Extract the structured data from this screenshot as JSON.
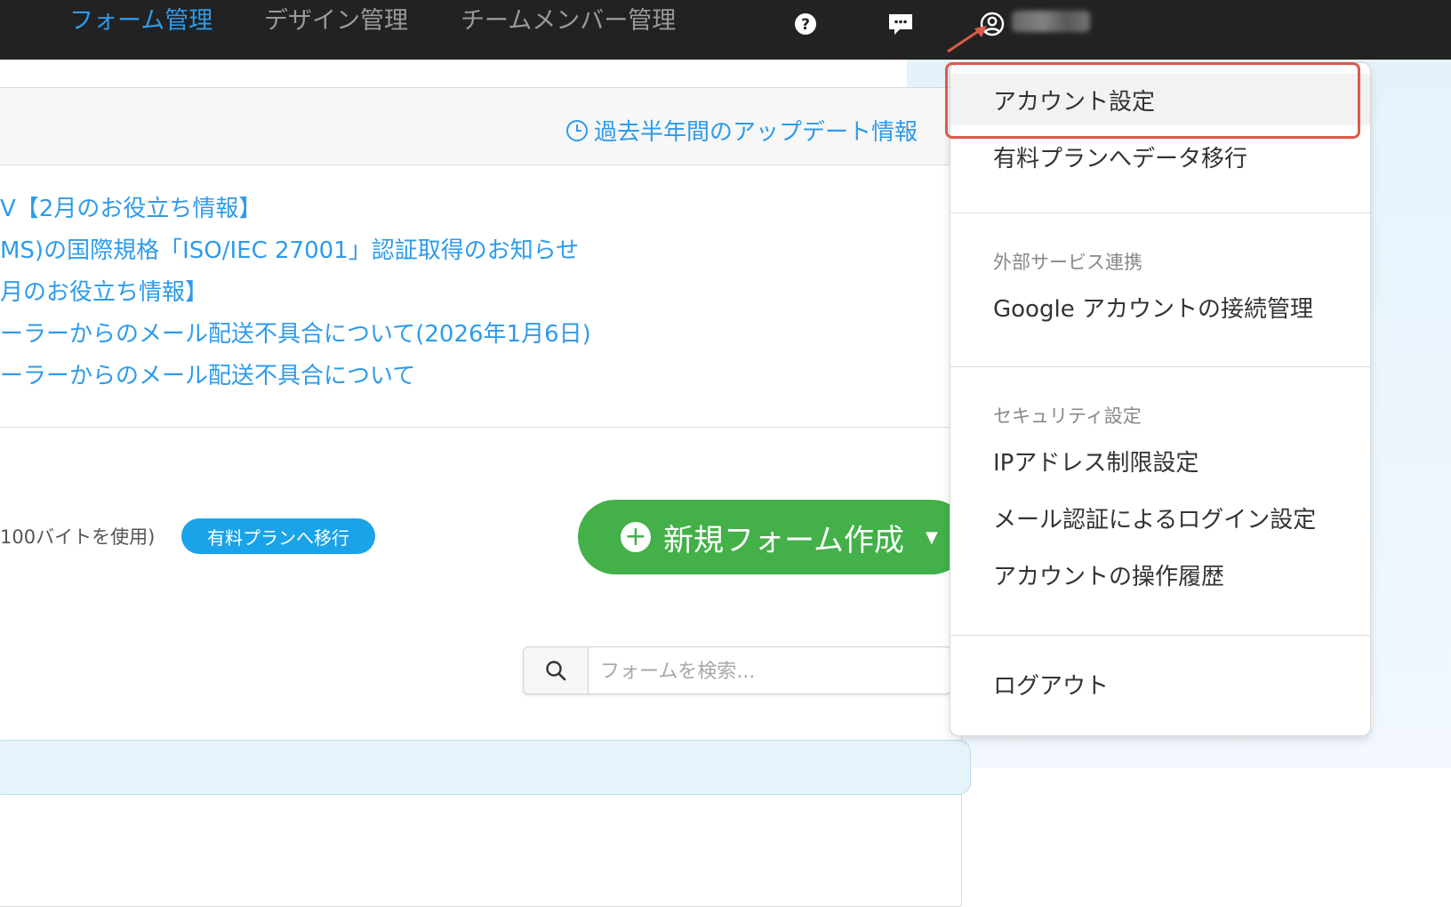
{
  "nav": {
    "tabs": [
      {
        "label": "フォーム管理",
        "active": true
      },
      {
        "label": "デザイン管理",
        "active": false
      },
      {
        "label": "チームメンバー管理",
        "active": false
      }
    ],
    "icons": [
      "help-icon",
      "chat-icon",
      "user-account-icon"
    ]
  },
  "main": {
    "update_link": "過去半年間のアップデート情報",
    "news": [
      "V【2月のお役立ち情報】",
      "MS)の国際規格「ISO/IEC 27001」認証取得のお知らせ",
      "月のお役立ち情報】",
      "ーラーからのメール配送不具合について(2026年1月6日)",
      "ーラーからのメール配送不具合について"
    ],
    "usage_text": "100バイトを使用)",
    "upgrade_button": "有料プランへ移行",
    "new_form_button": "新規フォーム作成",
    "search_placeholder": "フォームを検索..."
  },
  "dropdown": {
    "account_settings": "アカウント設定",
    "migrate_paid": "有料プランへデータ移行",
    "section_external": "外部サービス連携",
    "google_connect": "Google アカウントの接続管理",
    "section_security": "セキュリティ設定",
    "ip_restriction": "IPアドレス制限設定",
    "email_login": "メール認証によるログイン設定",
    "operation_history": "アカウントの操作履歴",
    "logout": "ログアウト"
  },
  "colors": {
    "accent_blue": "#2e9bea",
    "green": "#43b049",
    "highlight_red": "#dc5a4a",
    "topbar": "#222222"
  }
}
